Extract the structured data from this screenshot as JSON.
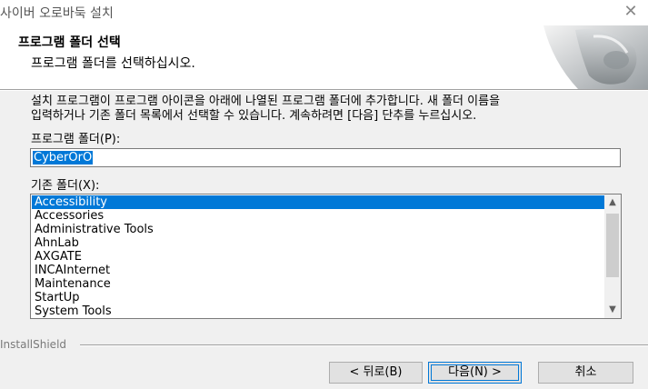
{
  "window": {
    "title": "사이버 오로바둑 설치",
    "close_symbol": "✕"
  },
  "header": {
    "title": "프로그램 폴더 선택",
    "subtitle": "프로그램 폴더를 선택하십시오."
  },
  "description": {
    "line1": "설치 프로그램이 프로그램 아이콘을 아래에 나열된 프로그램 폴더에 추가합니다. 새 폴더 이름을",
    "line2": "입력하거나 기존 폴더 목록에서 선택할 수 있습니다. 계속하려면 [다음] 단추를 누르십시오."
  },
  "program_folder": {
    "label": "프로그램 폴더(P):",
    "value": "CyberOrO"
  },
  "existing_folders": {
    "label": "기존 폴더(X):",
    "items": [
      "Accessibility",
      "Accessories",
      "Administrative Tools",
      "AhnLab",
      "AXGATE",
      "INCAInternet",
      "Maintenance",
      "StartUp",
      "System Tools"
    ],
    "selected_index": 0
  },
  "installshield": {
    "label": "InstallShield"
  },
  "buttons": {
    "back": "< 뒤로(B)",
    "next": "다음(N) >",
    "cancel": "취소"
  },
  "colors": {
    "selection": "#0078d7",
    "background": "#f0f0f0"
  }
}
